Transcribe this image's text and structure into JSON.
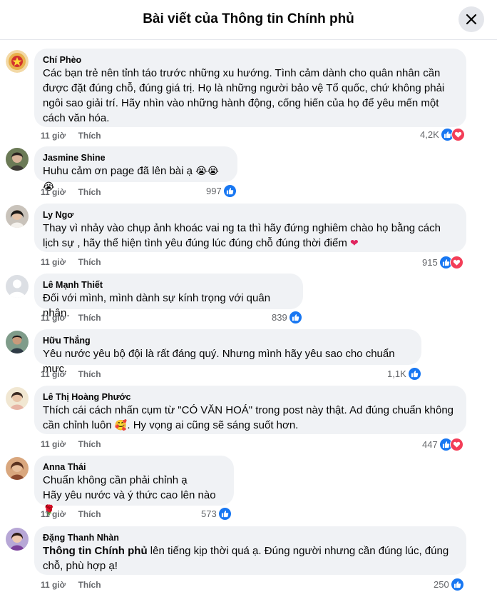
{
  "header": {
    "title": "Bài viết của Thông tin Chính phủ"
  },
  "comments": [
    {
      "author": "Chí Phèo",
      "text": "Các bạn trẻ nên tỉnh táo trước những xu hướng. Tình cảm dành cho quân nhân cần được đặt đúng chỗ, đúng giá trị. Họ là những người bảo vệ Tổ quốc, chứ không phải ngôi sao giải trí. Hãy nhìn vào những hành động, cống hiến của họ để yêu mến một cách văn hóa.",
      "time": "11 giờ",
      "like": "Thích",
      "reactions": "4,2K"
    },
    {
      "author": "Jasmine Shine",
      "text": "Huhu cảm ơn page đã lên bài ạ",
      "emoji": "😭😭😭",
      "time": "11 giờ",
      "like": "Thích",
      "reactions": "997"
    },
    {
      "author": "Ly Ngơ",
      "text": "Thay vì nhảy vào chụp ảnh khoác vai ng ta thì hãy đứng nghiêm chào họ bằng cách lịch sự , hãy thể hiện tình yêu đúng lúc đúng chỗ đúng thời điểm",
      "emoji": "❤",
      "time": "11 giờ",
      "like": "Thích",
      "reactions": "915"
    },
    {
      "author": "Lê Mạnh Thiết",
      "text": "Đối với mình, mình dành sự kính trọng với quân nhân.",
      "time": "11 giờ",
      "like": "Thích",
      "reactions": "839"
    },
    {
      "author": "Hữu Thắng",
      "text": "Yêu nước yêu bộ đội là rất đáng quý. Nhưng mình hãy yêu sao cho chuẩn mực.",
      "time": "11 giờ",
      "like": "Thích",
      "reactions": "1,1K"
    },
    {
      "author": "Lê Thị Hoàng Phước",
      "text_a": "Thích cái cách nhấn cụm từ \"CÓ VĂN HOÁ\" trong post này thật. Ad đúng chuẩn không cần chỉnh luôn",
      "emoji": "🥰",
      "text_b": ". Hy vọng ai cũng sẽ sáng suốt hơn.",
      "time": "11 giờ",
      "like": "Thích",
      "reactions": "447"
    },
    {
      "author": "Anna Thái",
      "line1": "Chuẩn không cần phải chỉnh ạ",
      "line2": "Hãy yêu nước và ý thức cao lên nào",
      "emoji": "🌹",
      "time": "11 giờ",
      "like": "Thích",
      "reactions": "573"
    },
    {
      "author": "Đặng Thanh Nhàn",
      "mention": "Thông tin Chính phủ",
      "text": " lên tiếng kịp thời quá ạ. Đúng người nhưng cần đúng lúc, đúng chỗ, phù hợp ạ!",
      "time": "11 giờ",
      "like": "Thích",
      "reactions": "250"
    }
  ],
  "colors": {
    "like_blue": "#1877f2",
    "heart_red": "#f33e58",
    "bubble_bg": "#f0f2f5",
    "meta_gray": "#65676b"
  },
  "icons": {
    "close": "close-icon",
    "like": "like-reaction-icon",
    "love": "love-reaction-icon"
  }
}
